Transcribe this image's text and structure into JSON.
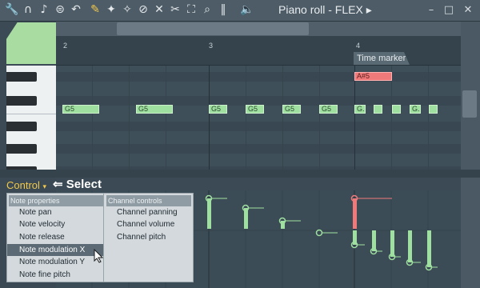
{
  "window": {
    "title": "Piano roll - FLEX",
    "title_arrow": "▸",
    "icons": [
      "wrench-icon",
      "magnet-icon",
      "note-icon",
      "menu-icon",
      "undo-icon",
      "pencil-icon",
      "paint-icon",
      "erase-icon",
      "delete-icon",
      "mute-icon",
      "slice-icon",
      "select-icon",
      "zoom-icon",
      "playback-icon",
      "speaker-icon"
    ],
    "buttons": {
      "minimize": "–",
      "maximize": "□",
      "close": "✕"
    }
  },
  "ruler": {
    "bars": [
      "2",
      "3",
      "4"
    ],
    "time_marker": "Time marker"
  },
  "notes": [
    {
      "label": "G5",
      "color": "#9fe0a0"
    },
    {
      "label": "G5",
      "color": "#9fe0a0"
    },
    {
      "label": "G5",
      "color": "#9fe0a0"
    },
    {
      "label": "G5",
      "color": "#9fe0a0"
    },
    {
      "label": "G5",
      "color": "#9fe0a0"
    },
    {
      "label": "G5",
      "color": "#9fe0a0"
    },
    {
      "label": "G.",
      "color": "#9fe0a0"
    },
    {
      "label": "",
      "color": "#9fe0a0"
    },
    {
      "label": "",
      "color": "#9fe0a0"
    },
    {
      "label": "G.",
      "color": "#9fe0a0"
    },
    {
      "label": "",
      "color": "#9fe0a0"
    },
    {
      "label": "A#5",
      "color": "#f07a7a"
    }
  ],
  "event_editor": {
    "control_label": "Control",
    "select_annotation": "Select",
    "arrow": "⇐"
  },
  "menu": {
    "note_properties_header": "Note properties",
    "channel_controls_header": "Channel controls",
    "note_properties": [
      "Note pan",
      "Note velocity",
      "Note release",
      "Note modulation X",
      "Note modulation Y",
      "Note fine pitch"
    ],
    "channel_controls": [
      "Channel panning",
      "Channel volume",
      "Channel pitch"
    ],
    "selected": "Note modulation X"
  },
  "colors": {
    "accent": "#f2c84b",
    "note_green": "#9fe0a0",
    "note_red": "#f07a7a"
  }
}
